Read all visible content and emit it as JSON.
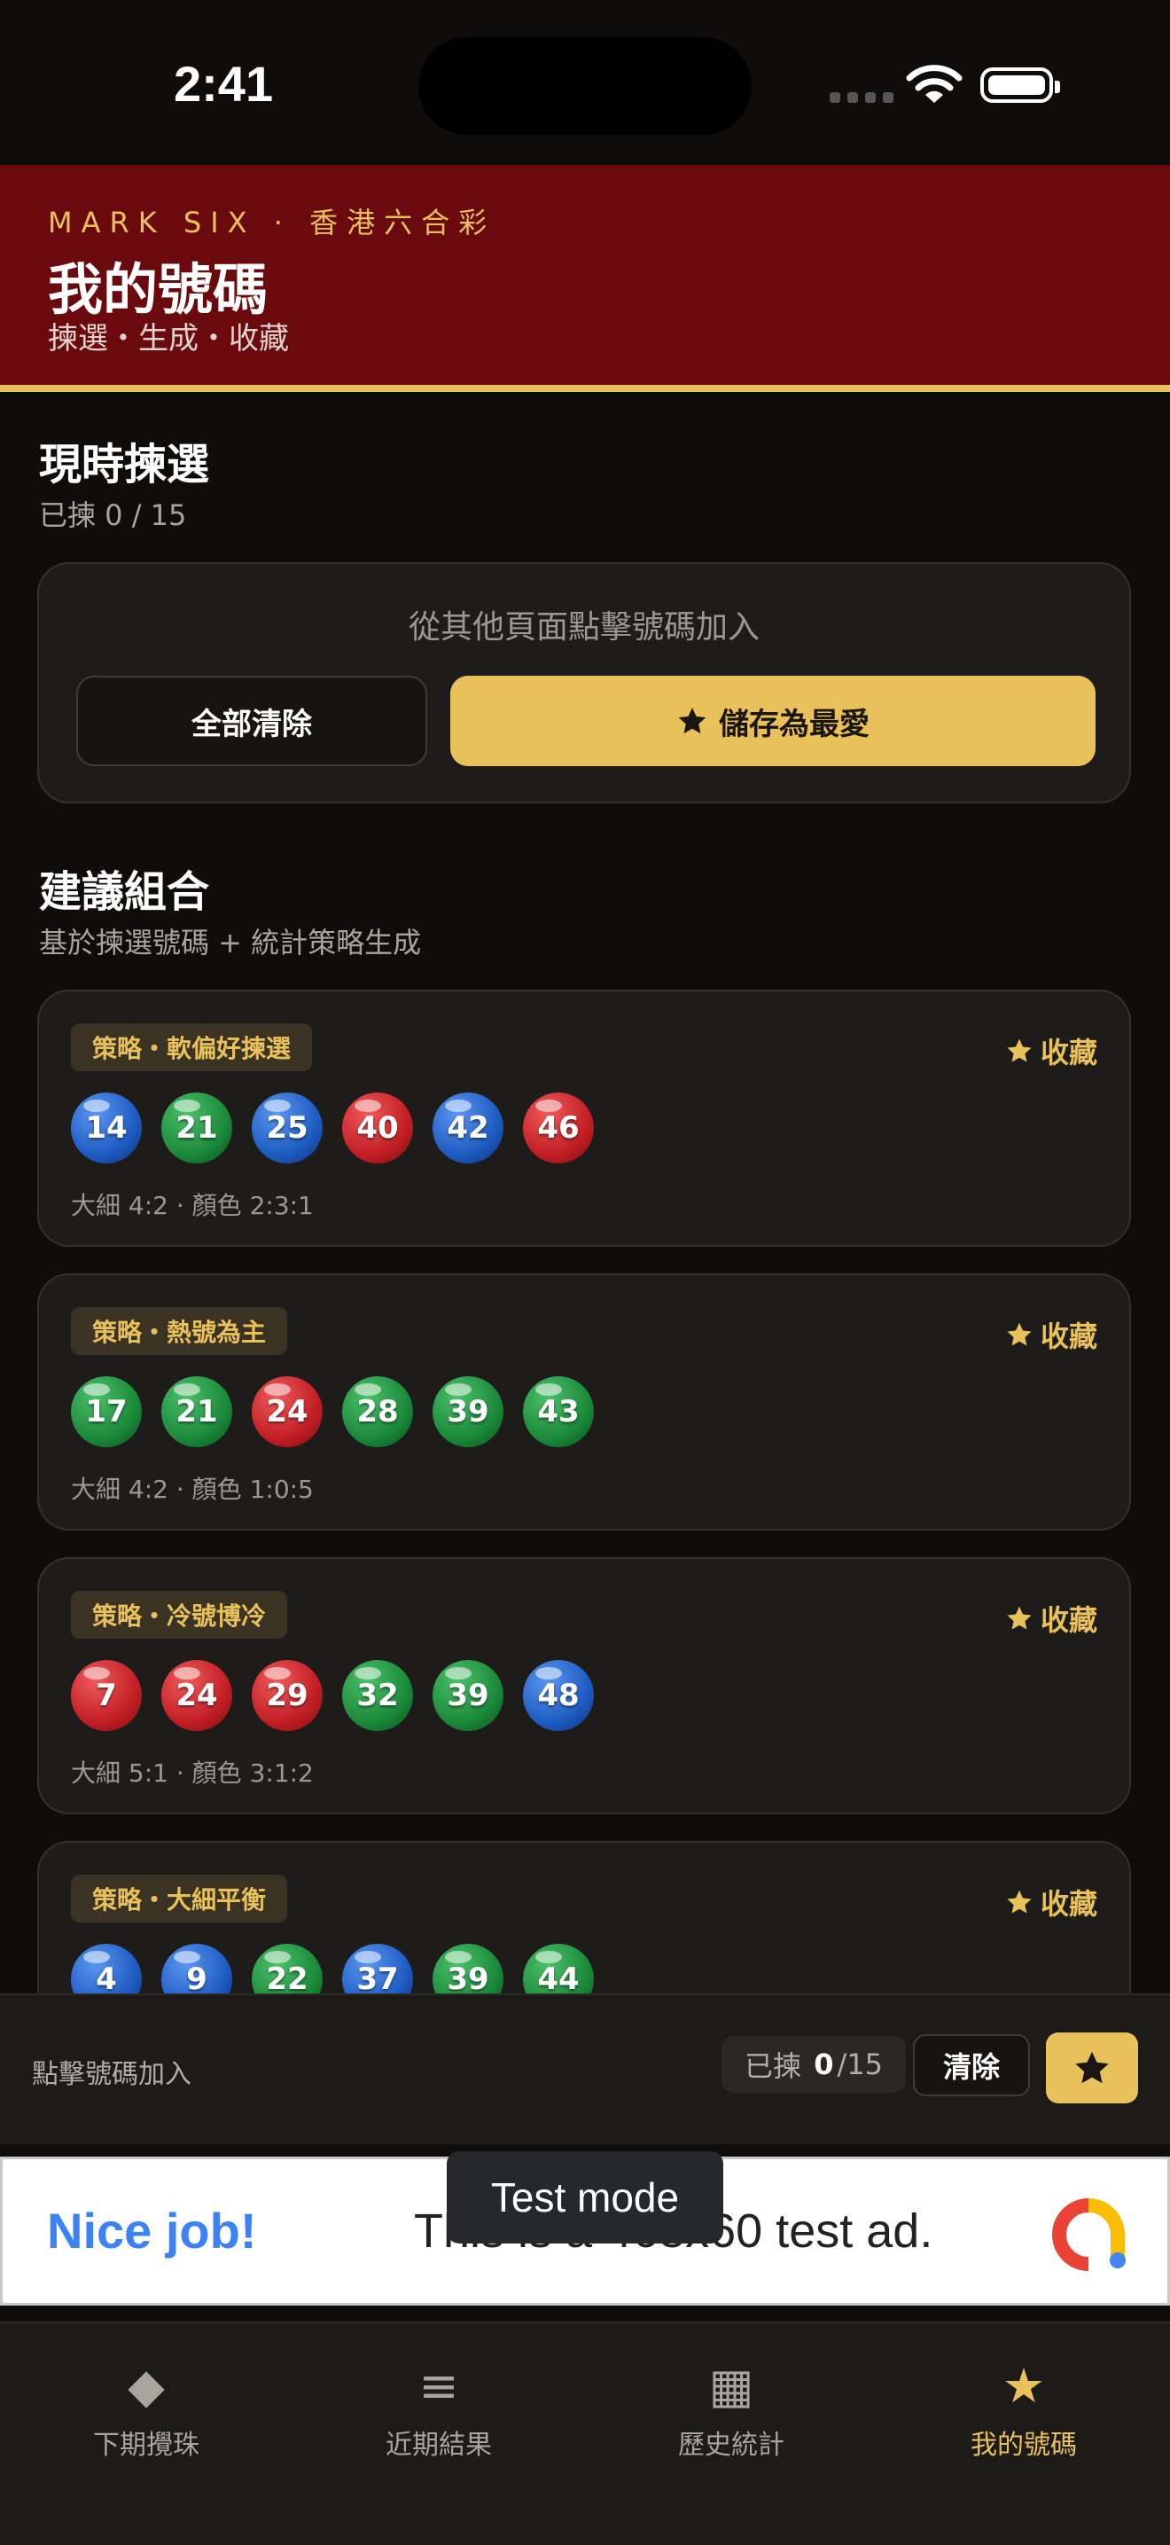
{
  "status_bar": {
    "time": "2:41"
  },
  "header": {
    "kicker": "MARK SIX · 香港六合彩",
    "title": "我的號碼",
    "subtitle": "揀選・生成・收藏"
  },
  "current": {
    "title": "現時揀選",
    "count": "已揀 0 / 15",
    "hint": "從其他頁面點擊號碼加入",
    "clear_label": "全部清除",
    "save_label": "儲存為最愛"
  },
  "suggest": {
    "title": "建議組合",
    "subtitle": "基於揀選號碼 + 統計策略生成",
    "fav_label": "收藏",
    "cards": [
      {
        "tag": "策略・軟偏好揀選",
        "meta": "大細 4:2 · 顏色 2:3:1",
        "balls": [
          {
            "n": "14",
            "c": "blue"
          },
          {
            "n": "21",
            "c": "green"
          },
          {
            "n": "25",
            "c": "blue"
          },
          {
            "n": "40",
            "c": "red"
          },
          {
            "n": "42",
            "c": "blue"
          },
          {
            "n": "46",
            "c": "red"
          }
        ]
      },
      {
        "tag": "策略・熱號為主",
        "meta": "大細 4:2 · 顏色 1:0:5",
        "balls": [
          {
            "n": "17",
            "c": "green"
          },
          {
            "n": "21",
            "c": "green"
          },
          {
            "n": "24",
            "c": "red"
          },
          {
            "n": "28",
            "c": "green"
          },
          {
            "n": "39",
            "c": "green"
          },
          {
            "n": "43",
            "c": "green"
          }
        ]
      },
      {
        "tag": "策略・冷號博冷",
        "meta": "大細 5:1 · 顏色 3:1:2",
        "balls": [
          {
            "n": "7",
            "c": "red"
          },
          {
            "n": "24",
            "c": "red"
          },
          {
            "n": "29",
            "c": "red"
          },
          {
            "n": "32",
            "c": "green"
          },
          {
            "n": "39",
            "c": "green"
          },
          {
            "n": "48",
            "c": "blue"
          }
        ]
      },
      {
        "tag": "策略・大細平衡",
        "meta": "",
        "balls": [
          {
            "n": "4",
            "c": "blue"
          },
          {
            "n": "9",
            "c": "blue"
          },
          {
            "n": "22",
            "c": "green"
          },
          {
            "n": "37",
            "c": "blue"
          },
          {
            "n": "39",
            "c": "green"
          },
          {
            "n": "44",
            "c": "green"
          }
        ]
      }
    ]
  },
  "bottom_bar": {
    "hint": "點擊號碼加入",
    "count_prefix": "已揀",
    "count_value": "0",
    "count_total": "/15",
    "clear_label": "清除"
  },
  "ad": {
    "headline": "Nice job!",
    "text": "This is a 468x60 test ad.",
    "toast": "Test mode"
  },
  "tabs": [
    {
      "label": "下期攪珠",
      "icon": "diamond-icon"
    },
    {
      "label": "近期結果",
      "icon": "list-icon"
    },
    {
      "label": "歷史統計",
      "icon": "grid-icon"
    },
    {
      "label": "我的號碼",
      "icon": "star-icon",
      "active": true
    }
  ],
  "colors": {
    "accent": "#e8c15a",
    "hero_bg": "#6a0a0e",
    "ball_red": "#c21f25",
    "ball_blue": "#1f5cc2",
    "ball_green": "#1b8a3a"
  }
}
